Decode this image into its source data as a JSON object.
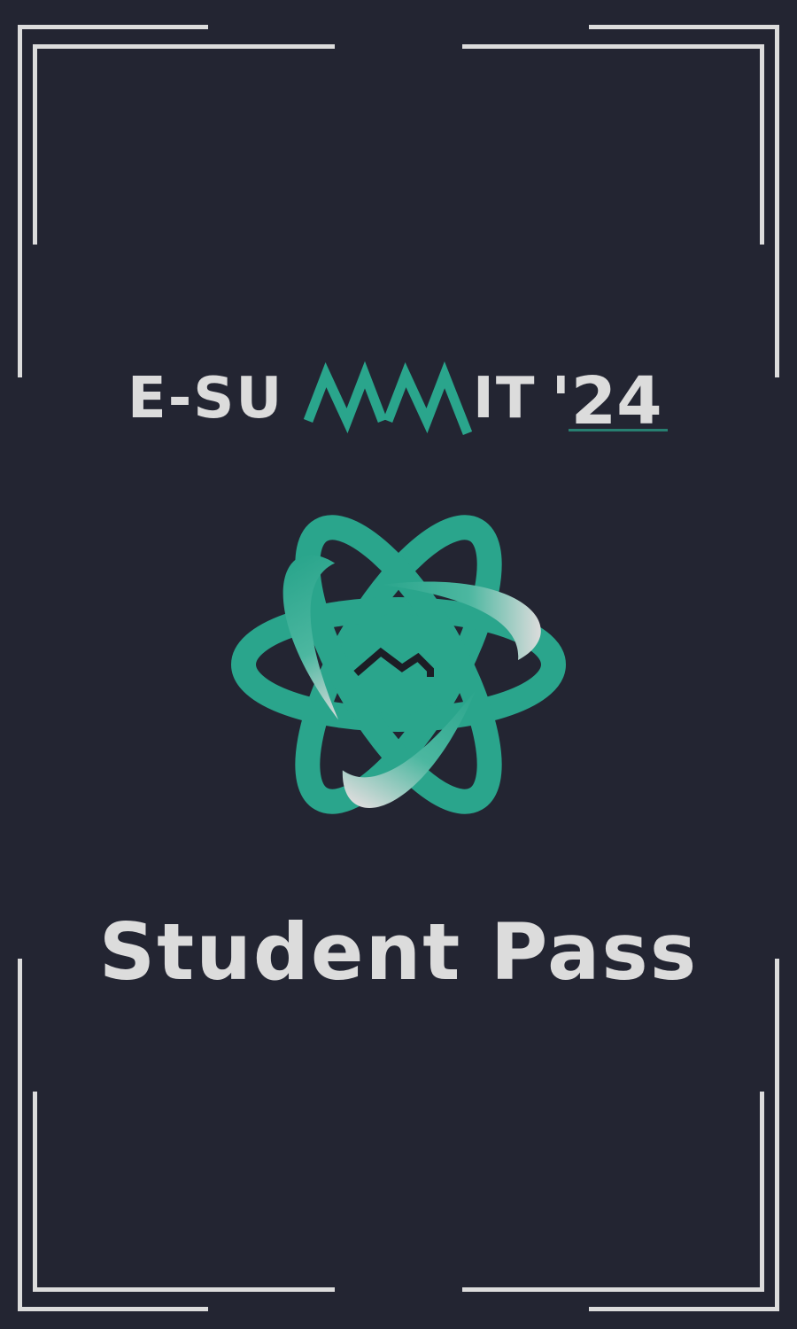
{
  "event": {
    "title_part1": "E-SU",
    "title_part2": "IT",
    "title_year": "'24",
    "title_full": "E-SUMMIT'24"
  },
  "pass": {
    "label": "Student Pass"
  },
  "colors": {
    "background": "#232532",
    "accent": "#2aa58c",
    "light": "#dcdcdc",
    "dark_mark": "#1c1d25"
  },
  "icons": {
    "logo": "atom-mountain-logo-icon",
    "mountain": "mountain-icon"
  }
}
